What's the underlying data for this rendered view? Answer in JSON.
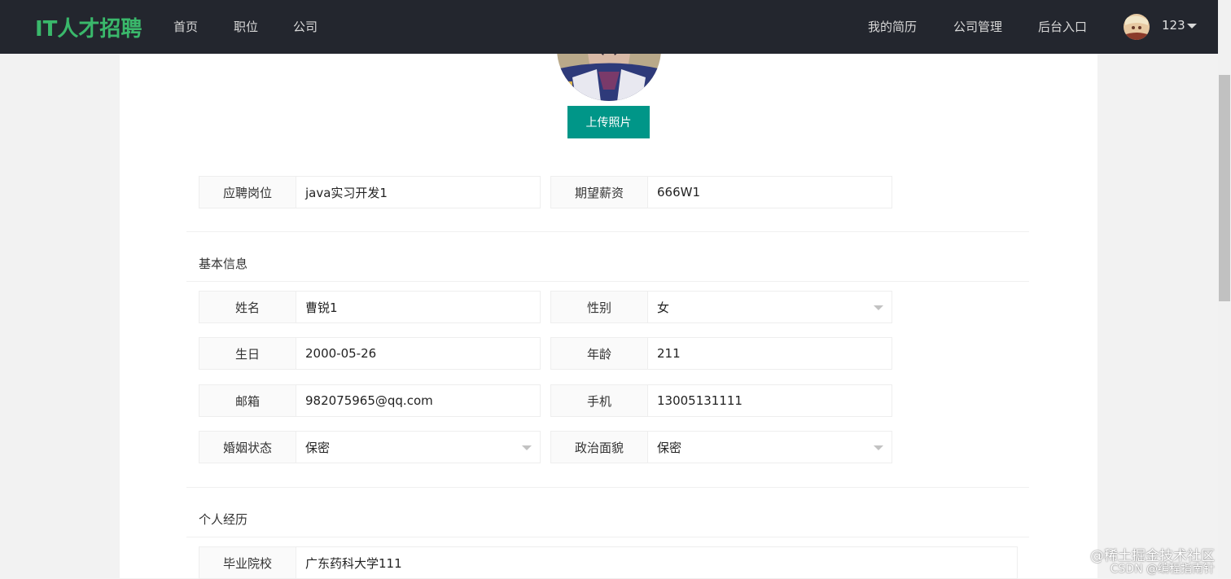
{
  "navbar": {
    "logo": "IT人才招聘",
    "links": [
      "首页",
      "职位",
      "公司"
    ],
    "right_links": [
      "我的简历",
      "公司管理",
      "后台入口"
    ],
    "user": "123"
  },
  "upload_label": "上传照片",
  "job": {
    "position_label": "应聘岗位",
    "position_value": "java实习开发1",
    "salary_label": "期望薪资",
    "salary_value": "666W1"
  },
  "basic": {
    "title": "基本信息",
    "name_label": "姓名",
    "name_value": "曹锐1",
    "gender_label": "性别",
    "gender_value": "女",
    "birthday_label": "生日",
    "birthday_value": "2000-05-26",
    "age_label": "年龄",
    "age_value": "211",
    "email_label": "邮箱",
    "email_value": "982075965@qq.com",
    "phone_label": "手机",
    "phone_value": "13005131111",
    "marital_label": "婚姻状态",
    "marital_value": "保密",
    "political_label": "政治面貌",
    "political_value": "保密"
  },
  "experience": {
    "title": "个人经历",
    "school_label": "毕业院校",
    "school_value": "广东药科大学111"
  },
  "watermark": {
    "line1": "@稀土掘金技术社区",
    "line2": "CSDN @编程指南针"
  },
  "icons": {
    "dropdown": "caret-down-icon",
    "avatar": "user-avatar"
  }
}
